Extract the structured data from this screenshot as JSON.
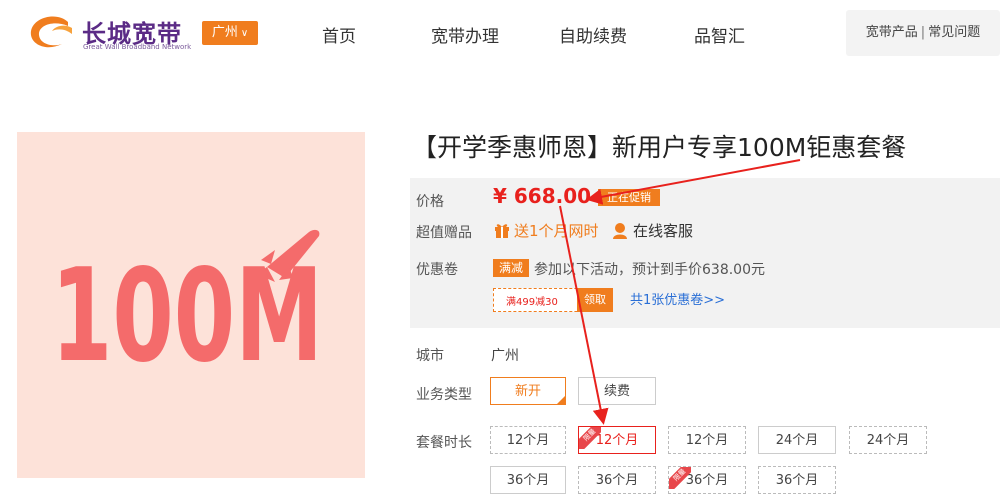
{
  "header": {
    "logo_text": "长城宽带",
    "logo_sub": "Great Wall Broadband Network",
    "city": "广州",
    "nav": [
      "首页",
      "宽带办理",
      "自助续费",
      "品智汇"
    ],
    "right_link_1": "宽带产品",
    "right_sep": "|",
    "right_link_2": "常见问题"
  },
  "product": {
    "image_text": "100M",
    "title": "【开学季惠师恩】新用户专享100M钜惠套餐",
    "price_label": "价格",
    "price": "¥ 668.00",
    "promo_tag": "正在促销",
    "gift_label": "超值赠品",
    "gift_text": "送1个月网时",
    "service_text": "在线客服",
    "coupon_label": "优惠卷",
    "full_tag": "满减",
    "discount_text": "参加以下活动，预计到手价638.00元",
    "coupon_amount": "满499减30",
    "coupon_take": "领取",
    "coupon_link": "共1张优惠卷>>",
    "city_label": "城市",
    "city_value": "广州",
    "type_label": "业务类型",
    "types": [
      "新开",
      "续费"
    ],
    "duration_label": "套餐时长",
    "durations_row1": [
      "12个月",
      "12个月",
      "12个月",
      "24个月",
      "24个月"
    ],
    "durations_row2": [
      "36个月",
      "36个月",
      "36个月",
      "36个月"
    ],
    "flag_text": "限量"
  },
  "colors": {
    "accent": "#f07d1e",
    "price": "#e8211d",
    "brand": "#5b2b86"
  }
}
